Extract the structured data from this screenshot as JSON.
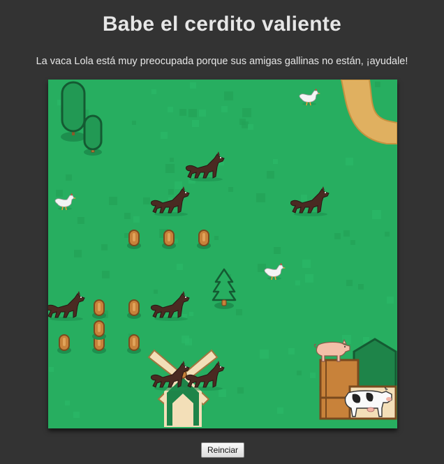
{
  "header": {
    "title": "Babe el cerdito valiente",
    "subtitle": "La vaca Lola está muy preocupada porque sus amigas gallinas no están, ¡ayudale!"
  },
  "controls": {
    "reset_label": "Reinciar"
  },
  "colors": {
    "background": "#333333",
    "grass": "#27ae60",
    "path": "#e0b060",
    "tree": "#1e8449"
  },
  "board": {
    "cols": 10,
    "rows": 10,
    "wolves": [
      [
        4,
        2
      ],
      [
        3,
        3
      ],
      [
        7,
        3
      ],
      [
        0,
        6
      ],
      [
        3,
        6
      ],
      [
        3,
        8
      ],
      [
        4,
        8
      ]
    ],
    "chickens": [
      [
        7,
        0
      ],
      [
        0,
        3
      ],
      [
        6,
        5
      ]
    ],
    "pig": [
      8,
      8
    ],
    "cow": [
      9,
      9
    ],
    "trees_tall": [
      [
        0,
        0
      ],
      [
        1,
        1
      ]
    ],
    "pine": [
      [
        5,
        5
      ]
    ],
    "stumps": [
      [
        3,
        4
      ],
      [
        4,
        4
      ],
      [
        2,
        4
      ],
      [
        1,
        6
      ],
      [
        2,
        6
      ],
      [
        0,
        7
      ],
      [
        1,
        7
      ],
      [
        1,
        6.6
      ],
      [
        2,
        7
      ]
    ],
    "windmill": [
      3,
      9
    ],
    "barn": [
      9,
      8
    ]
  }
}
